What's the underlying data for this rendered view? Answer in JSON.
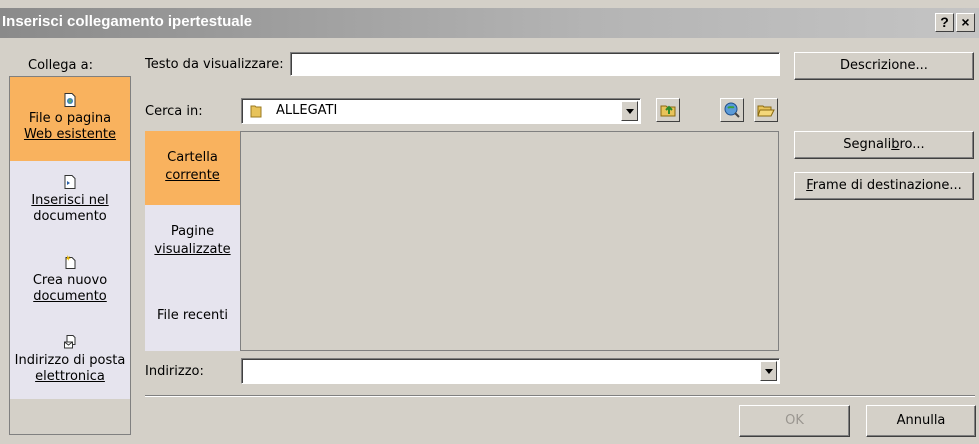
{
  "window": {
    "title": "Inserisci collegamento ipertestuale",
    "help_glyph": "?",
    "close_glyph": "×"
  },
  "sidebar": {
    "header": "Collega a:",
    "items": [
      {
        "label_a": "File o pagina",
        "label_b": "Web esistente",
        "icon": "file-page-icon"
      },
      {
        "label_a": "Inserisci nel",
        "label_b": "documento",
        "icon": "document-place-icon"
      },
      {
        "label_a": "Crea nuovo",
        "label_b": "documento",
        "icon": "new-document-icon"
      },
      {
        "label_a": "Indirizzo di posta",
        "label_b": "elettronica",
        "icon": "email-icon"
      }
    ]
  },
  "text_to_display": {
    "label": "Testo da visualizzare:",
    "value": ""
  },
  "look_in": {
    "label": "Cerca in:",
    "value": "ALLEGATI"
  },
  "subnav": {
    "items": [
      {
        "label_a": "Cartella",
        "label_b": "corrente"
      },
      {
        "label_a": "Pagine",
        "label_b": "visualizzate"
      },
      {
        "label_a": "File recenti",
        "label_b": ""
      }
    ]
  },
  "address": {
    "label": "Indirizzo:",
    "value": ""
  },
  "buttons": {
    "description": "Descrizione...",
    "bookmark": "Segnalibro...",
    "target_frame": "Frame di destinazione...",
    "ok": "OK",
    "cancel": "Annulla"
  }
}
